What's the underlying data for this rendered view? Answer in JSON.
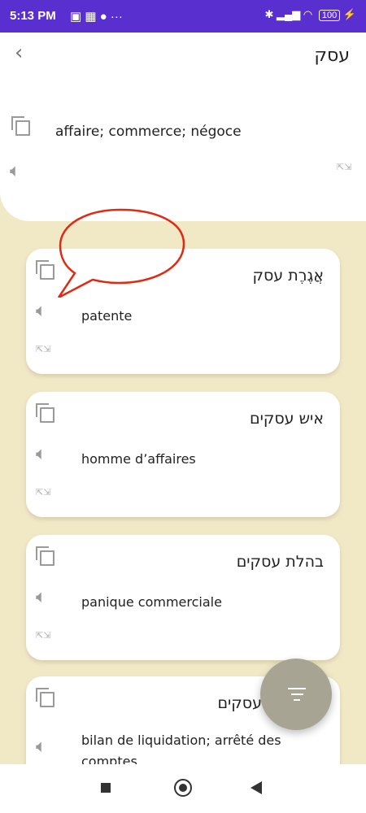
{
  "status": {
    "time": "5:13 PM",
    "battery": "100"
  },
  "header": {
    "word": "עסק",
    "translation": "affaire; commerce; négoce"
  },
  "entries": [
    {
      "word": "אֲגֶרֶת עסק",
      "translation": "patente"
    },
    {
      "word": "איש עסקים",
      "translation": "homme d’affaires"
    },
    {
      "word": "בהלת עסקים",
      "translation": "panique commerciale"
    },
    {
      "word": "עסקים",
      "translation": "bilan de liquidation; arrêté des comptes"
    }
  ],
  "icons": {
    "back": "chevron-left-icon",
    "copy": "copy-icon",
    "speaker": "speaker-icon",
    "expand": "expand-icon",
    "filter": "filter-icon"
  },
  "colors": {
    "status_bar": "#5a2fd0",
    "background": "#f1e9c6",
    "fab": "#a8a494",
    "annotation": "#e02a12"
  }
}
